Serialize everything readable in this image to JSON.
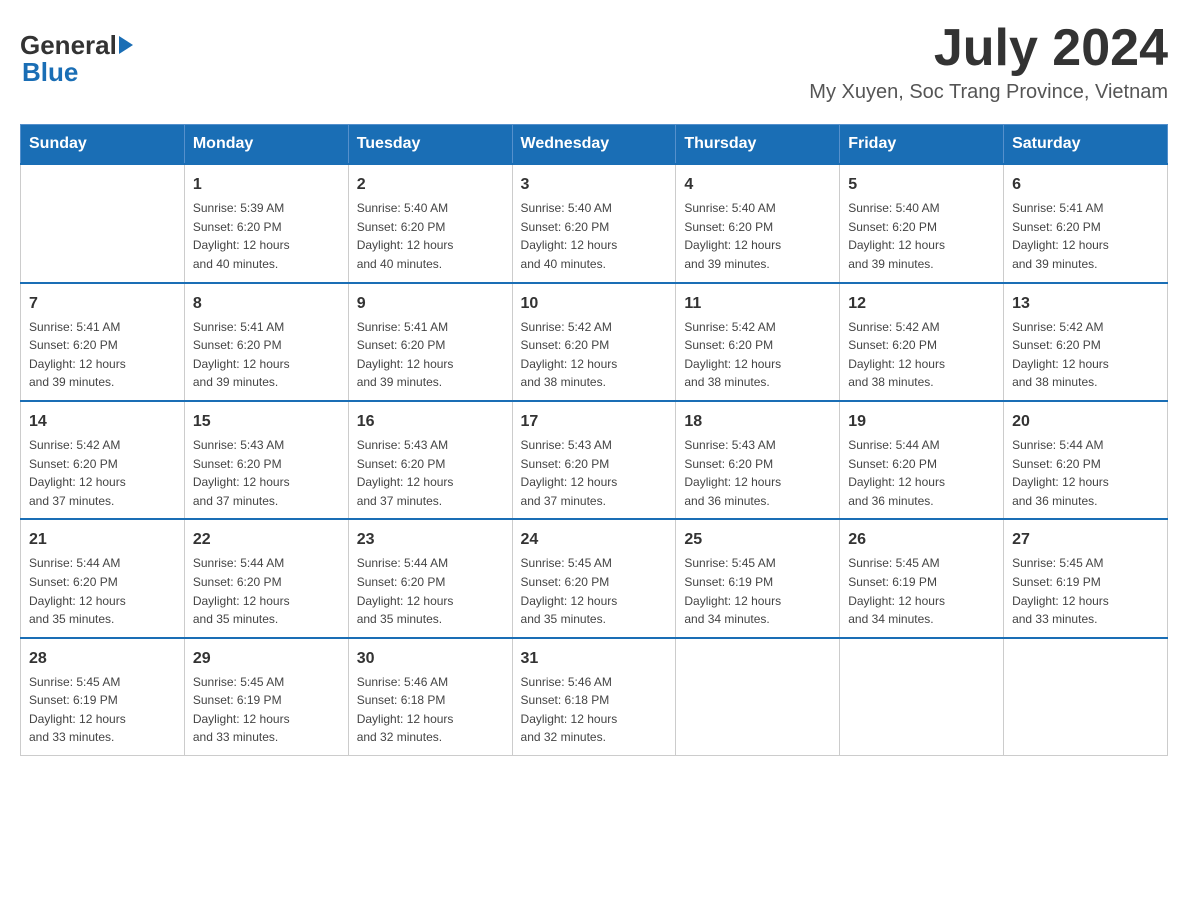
{
  "header": {
    "logo_general": "General",
    "logo_blue": "Blue",
    "month_title": "July 2024",
    "location": "My Xuyen, Soc Trang Province, Vietnam"
  },
  "days_of_week": [
    "Sunday",
    "Monday",
    "Tuesday",
    "Wednesday",
    "Thursday",
    "Friday",
    "Saturday"
  ],
  "weeks": [
    [
      {
        "day": "",
        "info": ""
      },
      {
        "day": "1",
        "info": "Sunrise: 5:39 AM\nSunset: 6:20 PM\nDaylight: 12 hours\nand 40 minutes."
      },
      {
        "day": "2",
        "info": "Sunrise: 5:40 AM\nSunset: 6:20 PM\nDaylight: 12 hours\nand 40 minutes."
      },
      {
        "day": "3",
        "info": "Sunrise: 5:40 AM\nSunset: 6:20 PM\nDaylight: 12 hours\nand 40 minutes."
      },
      {
        "day": "4",
        "info": "Sunrise: 5:40 AM\nSunset: 6:20 PM\nDaylight: 12 hours\nand 39 minutes."
      },
      {
        "day": "5",
        "info": "Sunrise: 5:40 AM\nSunset: 6:20 PM\nDaylight: 12 hours\nand 39 minutes."
      },
      {
        "day": "6",
        "info": "Sunrise: 5:41 AM\nSunset: 6:20 PM\nDaylight: 12 hours\nand 39 minutes."
      }
    ],
    [
      {
        "day": "7",
        "info": "Sunrise: 5:41 AM\nSunset: 6:20 PM\nDaylight: 12 hours\nand 39 minutes."
      },
      {
        "day": "8",
        "info": "Sunrise: 5:41 AM\nSunset: 6:20 PM\nDaylight: 12 hours\nand 39 minutes."
      },
      {
        "day": "9",
        "info": "Sunrise: 5:41 AM\nSunset: 6:20 PM\nDaylight: 12 hours\nand 39 minutes."
      },
      {
        "day": "10",
        "info": "Sunrise: 5:42 AM\nSunset: 6:20 PM\nDaylight: 12 hours\nand 38 minutes."
      },
      {
        "day": "11",
        "info": "Sunrise: 5:42 AM\nSunset: 6:20 PM\nDaylight: 12 hours\nand 38 minutes."
      },
      {
        "day": "12",
        "info": "Sunrise: 5:42 AM\nSunset: 6:20 PM\nDaylight: 12 hours\nand 38 minutes."
      },
      {
        "day": "13",
        "info": "Sunrise: 5:42 AM\nSunset: 6:20 PM\nDaylight: 12 hours\nand 38 minutes."
      }
    ],
    [
      {
        "day": "14",
        "info": "Sunrise: 5:42 AM\nSunset: 6:20 PM\nDaylight: 12 hours\nand 37 minutes."
      },
      {
        "day": "15",
        "info": "Sunrise: 5:43 AM\nSunset: 6:20 PM\nDaylight: 12 hours\nand 37 minutes."
      },
      {
        "day": "16",
        "info": "Sunrise: 5:43 AM\nSunset: 6:20 PM\nDaylight: 12 hours\nand 37 minutes."
      },
      {
        "day": "17",
        "info": "Sunrise: 5:43 AM\nSunset: 6:20 PM\nDaylight: 12 hours\nand 37 minutes."
      },
      {
        "day": "18",
        "info": "Sunrise: 5:43 AM\nSunset: 6:20 PM\nDaylight: 12 hours\nand 36 minutes."
      },
      {
        "day": "19",
        "info": "Sunrise: 5:44 AM\nSunset: 6:20 PM\nDaylight: 12 hours\nand 36 minutes."
      },
      {
        "day": "20",
        "info": "Sunrise: 5:44 AM\nSunset: 6:20 PM\nDaylight: 12 hours\nand 36 minutes."
      }
    ],
    [
      {
        "day": "21",
        "info": "Sunrise: 5:44 AM\nSunset: 6:20 PM\nDaylight: 12 hours\nand 35 minutes."
      },
      {
        "day": "22",
        "info": "Sunrise: 5:44 AM\nSunset: 6:20 PM\nDaylight: 12 hours\nand 35 minutes."
      },
      {
        "day": "23",
        "info": "Sunrise: 5:44 AM\nSunset: 6:20 PM\nDaylight: 12 hours\nand 35 minutes."
      },
      {
        "day": "24",
        "info": "Sunrise: 5:45 AM\nSunset: 6:20 PM\nDaylight: 12 hours\nand 35 minutes."
      },
      {
        "day": "25",
        "info": "Sunrise: 5:45 AM\nSunset: 6:19 PM\nDaylight: 12 hours\nand 34 minutes."
      },
      {
        "day": "26",
        "info": "Sunrise: 5:45 AM\nSunset: 6:19 PM\nDaylight: 12 hours\nand 34 minutes."
      },
      {
        "day": "27",
        "info": "Sunrise: 5:45 AM\nSunset: 6:19 PM\nDaylight: 12 hours\nand 33 minutes."
      }
    ],
    [
      {
        "day": "28",
        "info": "Sunrise: 5:45 AM\nSunset: 6:19 PM\nDaylight: 12 hours\nand 33 minutes."
      },
      {
        "day": "29",
        "info": "Sunrise: 5:45 AM\nSunset: 6:19 PM\nDaylight: 12 hours\nand 33 minutes."
      },
      {
        "day": "30",
        "info": "Sunrise: 5:46 AM\nSunset: 6:18 PM\nDaylight: 12 hours\nand 32 minutes."
      },
      {
        "day": "31",
        "info": "Sunrise: 5:46 AM\nSunset: 6:18 PM\nDaylight: 12 hours\nand 32 minutes."
      },
      {
        "day": "",
        "info": ""
      },
      {
        "day": "",
        "info": ""
      },
      {
        "day": "",
        "info": ""
      }
    ]
  ]
}
